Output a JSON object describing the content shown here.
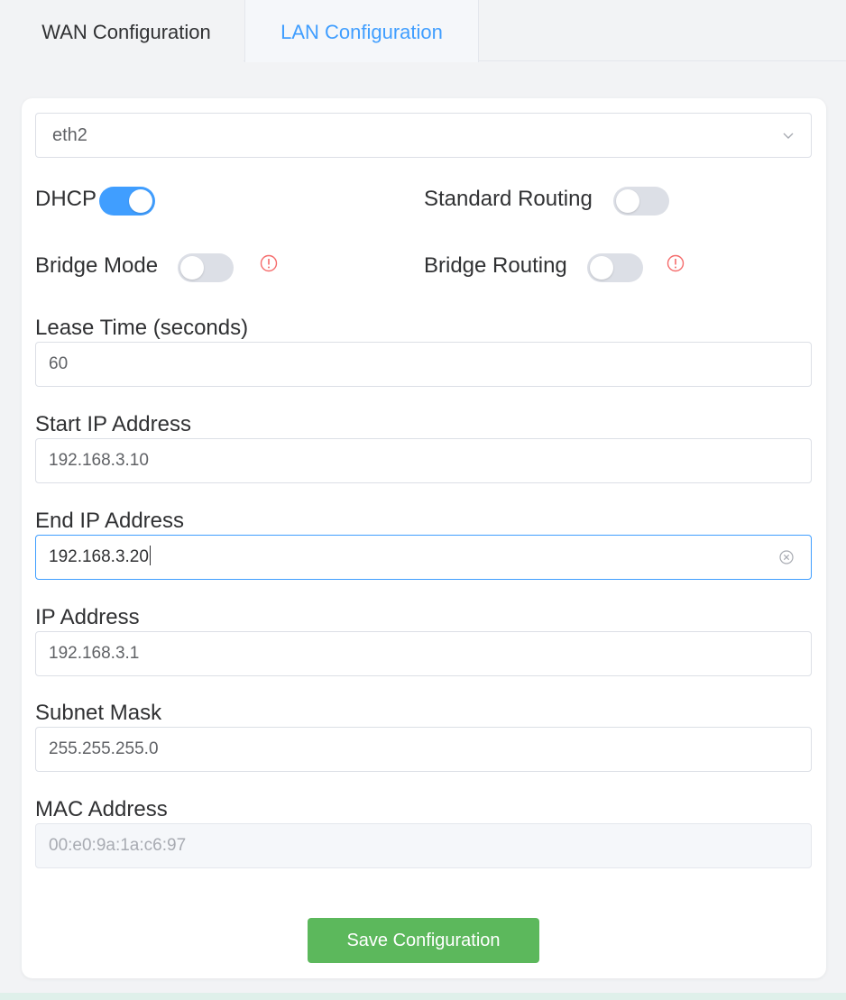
{
  "tabs": [
    {
      "label": "WAN Configuration",
      "active": false
    },
    {
      "label": "LAN Configuration",
      "active": true
    }
  ],
  "interface_select": {
    "value": "eth2",
    "icon": "chevron-down-icon"
  },
  "toggles": {
    "dhcp": {
      "label": "DHCP",
      "on": true
    },
    "standard_routing": {
      "label": "Standard Routing",
      "on": false
    },
    "bridge_mode": {
      "label": "Bridge Mode",
      "on": false,
      "icon": "warning-circle-icon"
    },
    "bridge_routing": {
      "label": "Bridge Routing",
      "on": false,
      "icon": "warning-circle-icon"
    }
  },
  "fields": {
    "lease_time": {
      "label": "Lease Time (seconds)",
      "value": "60"
    },
    "start_ip": {
      "label": "Start IP Address",
      "value": "192.168.3.10"
    },
    "end_ip": {
      "label": "End IP Address",
      "value": "192.168.3.20",
      "focused": true
    },
    "ip_address": {
      "label": "IP Address",
      "value": "192.168.3.1"
    },
    "subnet_mask": {
      "label": "Subnet Mask",
      "value": "255.255.255.0"
    },
    "mac_address": {
      "label": "MAC Address",
      "value": "00:e0:9a:1a:c6:97",
      "disabled": true
    }
  },
  "save_button": {
    "label": "Save Configuration"
  },
  "colors": {
    "accent": "#409eff",
    "save": "#5cb85c",
    "warning": "#f56c6c"
  }
}
